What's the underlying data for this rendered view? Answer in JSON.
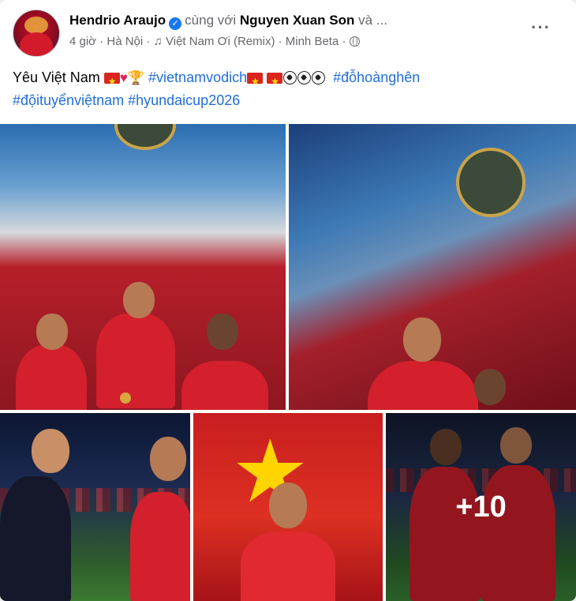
{
  "post": {
    "author": "Hendrio Araujo",
    "with_text": "cùng với",
    "tagged": "Nguyen Xuan Son",
    "and_more": "và ...",
    "time": "4 giờ",
    "location": "Hà Nội",
    "music": "Việt Nam Ơi (Remix) · Minh Beta",
    "more_menu": "···"
  },
  "caption": {
    "intro": "Yêu Việt Nam",
    "tag1": "#vietnamvodich",
    "tag2": "#đỗhoànghên",
    "tag3": "#độituyểnviệtnam",
    "tag4": "#hyundaicup2026"
  },
  "photos": {
    "more_count": "+10"
  },
  "icons": {
    "verified": "verified-badge",
    "music": "music-note-icon",
    "privacy": "globe-icon",
    "heart": "red-heart-emoji",
    "trophy": "trophy-emoji",
    "flag": "vietnam-flag-emoji",
    "ball": "soccer-ball-emoji"
  },
  "colors": {
    "link": "#216fdb",
    "verified": "#1877f2",
    "jersey_red": "#d3202c"
  }
}
